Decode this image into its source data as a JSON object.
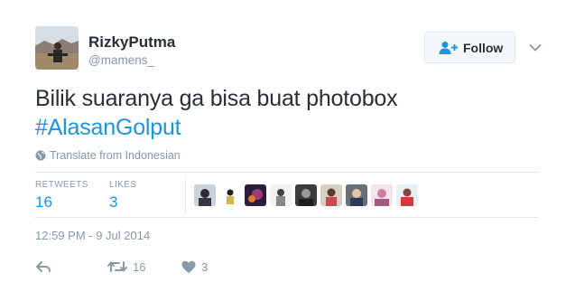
{
  "user": {
    "display_name": "RizkyPutma",
    "handle": "@mamens_"
  },
  "follow_button": {
    "label": "Follow"
  },
  "tweet": {
    "text_line1": "Bilik suaranya ga bisa buat photobox",
    "hashtag": "#AlasanGolput"
  },
  "translate": {
    "label": "Translate from Indonesian"
  },
  "stats": {
    "retweets_label": "RETWEETS",
    "retweets_count": "16",
    "likes_label": "LIKES",
    "likes_count": "3"
  },
  "timestamp": "12:59 PM - 9 Jul 2014",
  "actions": {
    "retweet_count": "16",
    "like_count": "3"
  },
  "colors": {
    "link": "#1b95e0",
    "meta_gray": "#8899a6",
    "text": "#292f33",
    "divider": "#e1e8ed"
  },
  "icons": [
    "user-avatar",
    "follow-person-plus-icon",
    "chevron-down-icon",
    "globe-icon",
    "reply-icon",
    "retweet-icon",
    "heart-icon"
  ]
}
